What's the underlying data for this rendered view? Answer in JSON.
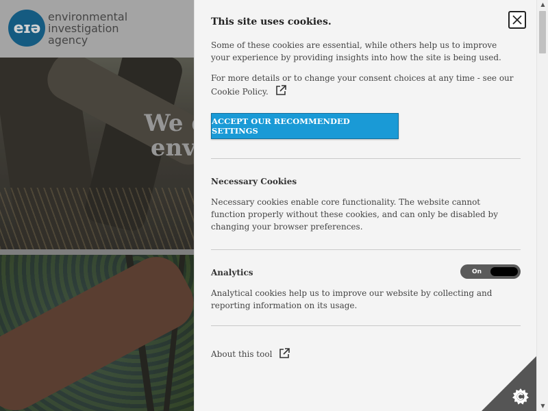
{
  "site": {
    "logo_mark": "eɪə",
    "logo_lines": [
      "environmental",
      "investigation",
      "agency"
    ],
    "hero_title_line1": "We defend",
    "hero_title_line2": "environm"
  },
  "cookie_panel": {
    "title": "This site uses cookies.",
    "intro": "Some of these cookies are essential, while others help us to improve your experience by providing insights into how the site is being used.",
    "details": "For more details or to change your consent choices at any time - see our Cookie Policy.",
    "accept_label": "ACCEPT OUR RECOMMENDED SETTINGS",
    "necessary": {
      "title": "Necessary Cookies",
      "text": "Necessary cookies enable core functionality. The website cannot function properly without these cookies, and can only be disabled by changing your browser preferences."
    },
    "analytics": {
      "title": "Analytics",
      "toggle_label": "On",
      "text": "Analytical cookies help us to improve our website by collecting and reporting information on its usage."
    },
    "about_label": "About this tool"
  },
  "icons": {
    "close": "close-icon",
    "external": "external-link-icon",
    "cookie_settings": "cookie-settings-icon",
    "scroll_up": "scroll-up-arrow",
    "scroll_down": "scroll-down-arrow"
  },
  "colors": {
    "accent": "#1a9ad6",
    "panel_bg": "#f4f4f4",
    "logo": "#1a6f9e",
    "toggle_bg": "#5a5a5a"
  }
}
